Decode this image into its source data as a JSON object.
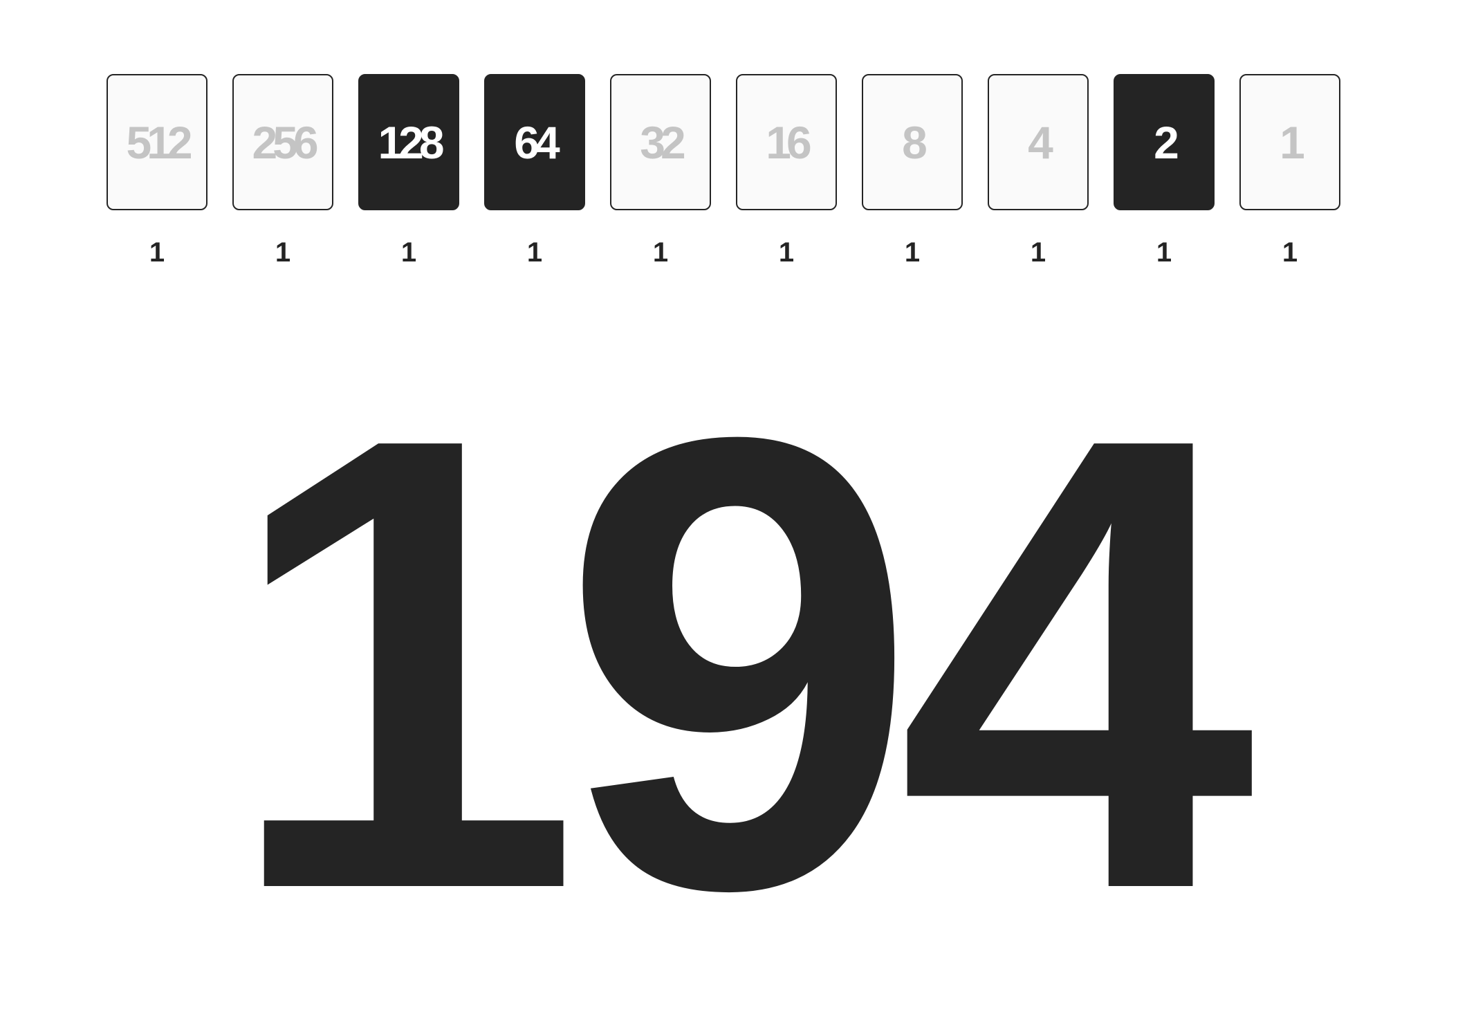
{
  "cards": [
    {
      "value": "512",
      "on": false,
      "bit": "1"
    },
    {
      "value": "256",
      "on": false,
      "bit": "1"
    },
    {
      "value": "128",
      "on": true,
      "bit": "1"
    },
    {
      "value": "64",
      "on": true,
      "bit": "1"
    },
    {
      "value": "32",
      "on": false,
      "bit": "1"
    },
    {
      "value": "16",
      "on": false,
      "bit": "1"
    },
    {
      "value": "8",
      "on": false,
      "bit": "1"
    },
    {
      "value": "4",
      "on": false,
      "bit": "1"
    },
    {
      "value": "2",
      "on": true,
      "bit": "1"
    },
    {
      "value": "1",
      "on": false,
      "bit": "1"
    }
  ],
  "total": "194",
  "colors": {
    "on_background": "#242424",
    "off_background": "#fafafa",
    "on_text": "#ffffff",
    "off_text": "#c4c4c4",
    "ink": "#242424"
  }
}
